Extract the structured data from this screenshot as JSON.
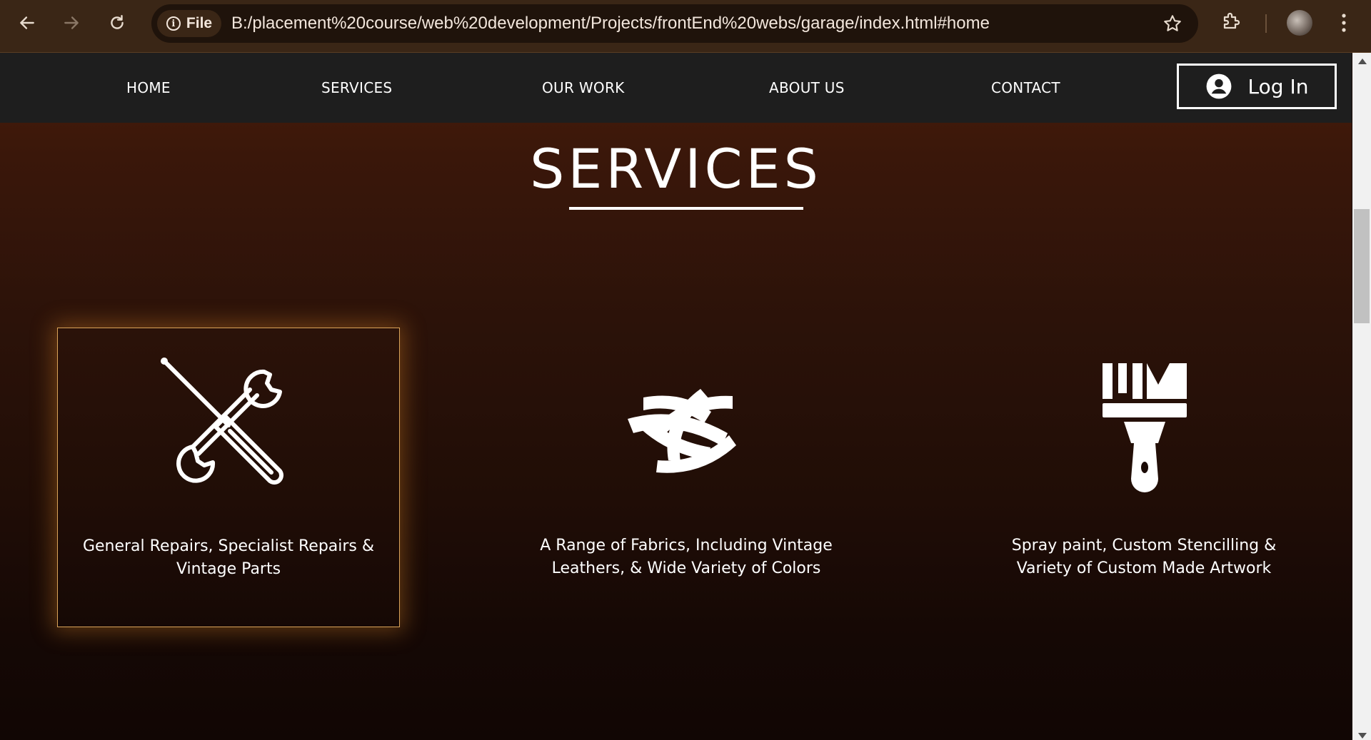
{
  "browser": {
    "url_chip_label": "File",
    "url": "B:/placement%20course/web%20development/Projects/frontEnd%20webs/garage/index.html#home",
    "icons": [
      "back-arrow-icon",
      "forward-arrow-icon",
      "reload-icon",
      "info-icon",
      "star-icon",
      "extensions-icon",
      "profile-avatar",
      "menu-dots-icon"
    ]
  },
  "nav": {
    "items": [
      "HOME",
      "SERVICES",
      "OUR WORK",
      "ABOUT US",
      "CONTACT"
    ],
    "login_label": "Log In",
    "login_icon": "user-circle-icon"
  },
  "services": {
    "title": "SERVICES",
    "cards": [
      {
        "icon": "wrench-screwdriver-icon",
        "text": "General Repairs, Specialist Repairs & Vintage Parts",
        "highlighted": true
      },
      {
        "icon": "woven-fabric-icon",
        "text": "A Range of Fabrics, Including Vintage Leathers, & Wide Variety of Colors",
        "highlighted": false
      },
      {
        "icon": "paint-brush-icon",
        "text": "Spray paint, Custom Stencilling & Variety of Custom Made Artwork",
        "highlighted": false
      }
    ]
  },
  "colors": {
    "nav_background": "#1e1e1e",
    "page_gradient_top": "#4a1d0c",
    "page_gradient_bottom": "#110604",
    "card_highlight_border": "#d9a35a",
    "text": "#ffffff"
  }
}
